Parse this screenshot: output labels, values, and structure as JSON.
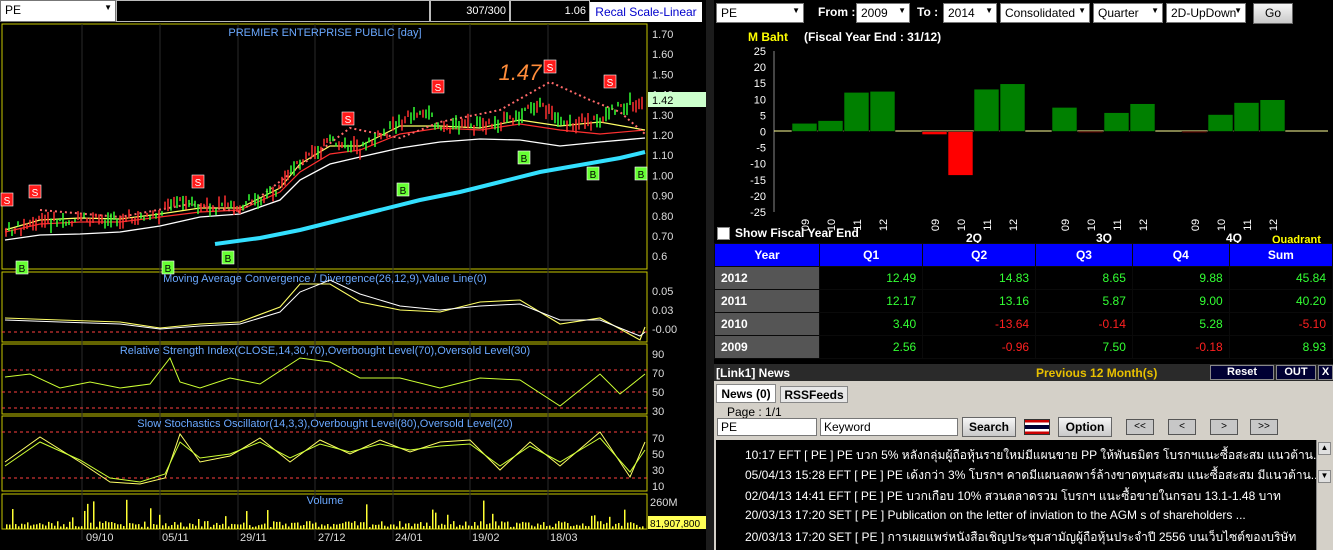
{
  "chart_header": {
    "symbol": "PE",
    "bars_count": "307/300",
    "zoom": "1.06",
    "scale_button": "Recal Scale-Linear",
    "title": "PREMIER ENTERPRISE PUBLIC [day]",
    "peak_label": "1.47",
    "last_price": "1.42"
  },
  "price_axis": [
    "1.70",
    "1.60",
    "1.50",
    "1.40",
    "1.30",
    "1.20",
    "1.10",
    "1.00",
    "0.90",
    "0.80",
    "0.70",
    "0.6"
  ],
  "indicators": {
    "macd": {
      "title": "Moving Average Convergence / Divergence(26,12,9),Value Line(0)",
      "ticks": [
        "0.05",
        "0.03",
        "-0.00"
      ]
    },
    "rsi": {
      "title": "Relative Strength Index(CLOSE,14,30,70),Overbought Level(70),Oversold Level(30)",
      "ticks": [
        "90",
        "70",
        "50",
        "30"
      ]
    },
    "stoch": {
      "title": "Slow Stochastics Oscillator(14,3,3),Overbought Level(80),Oversold Level(20)",
      "ticks": [
        "70",
        "50",
        "30",
        "10"
      ]
    },
    "volume": {
      "title": "Volume",
      "ticks": [
        "260M"
      ],
      "last": "81,907,800"
    }
  },
  "date_axis": [
    "09/10",
    "05/11",
    "29/11",
    "27/12",
    "24/01",
    "19/02",
    "18/03"
  ],
  "signals": {
    "sell": "S",
    "buy": "B"
  },
  "financial": {
    "symbol": "PE",
    "from_label": "From :",
    "from_year": "2009",
    "to_label": "To :",
    "to_year": "2014",
    "mode": "Consolidated",
    "period": "Quarter",
    "view": "2D-UpDown",
    "go_label": "Go",
    "chart_title": "M Baht",
    "fiscal_note": "(Fiscal Year End : 31/12)",
    "show_fiscal_label": "Show Fiscal Year End",
    "quadrant_label": "Quadrant"
  },
  "chart_data": {
    "type": "bar",
    "title": "M Baht",
    "subtitle": "(Fiscal Year End : 31/12)",
    "ylim": [
      -25,
      25
    ],
    "yticks": [
      "25",
      "20",
      "15",
      "10",
      "5",
      "0",
      "-5",
      "-10",
      "-15",
      "-20",
      "-25"
    ],
    "groups": [
      {
        "name": "1Q",
        "categories": [
          "09",
          "10",
          "11",
          "12"
        ],
        "values": [
          2.56,
          3.4,
          12.17,
          12.49
        ]
      },
      {
        "name": "2Q",
        "categories": [
          "09",
          "10",
          "11",
          "12"
        ],
        "values": [
          -0.96,
          -13.64,
          13.16,
          14.83
        ]
      },
      {
        "name": "3Q",
        "categories": [
          "09",
          "10",
          "11",
          "12"
        ],
        "values": [
          7.5,
          -0.14,
          5.87,
          8.65
        ]
      },
      {
        "name": "4Q",
        "categories": [
          "09",
          "10",
          "11",
          "12"
        ],
        "values": [
          -0.18,
          5.28,
          9.0,
          9.88
        ]
      }
    ],
    "group_labels_visible": [
      "2Q",
      "3Q",
      "4Q"
    ],
    "pos_color": "#008000",
    "neg_color": "#ff0000"
  },
  "table": {
    "headers": [
      "Year",
      "Q1",
      "Q2",
      "Q3",
      "Q4",
      "Sum"
    ],
    "rows": [
      [
        "2012",
        "12.49",
        "14.83",
        "8.65",
        "9.88",
        "45.84"
      ],
      [
        "2011",
        "12.17",
        "13.16",
        "5.87",
        "9.00",
        "40.20"
      ],
      [
        "2010",
        "3.40",
        "-13.64",
        "-0.14",
        "5.28",
        "-5.10"
      ],
      [
        "2009",
        "2.56",
        "-0.96",
        "7.50",
        "-0.18",
        "8.93"
      ]
    ]
  },
  "news_panel": {
    "title": "[Link1] News",
    "range": "Previous 12 Month(s)",
    "reset": "Reset",
    "out": "OUT",
    "close": "X",
    "tabs": [
      "News (0)",
      "RSSFeeds"
    ],
    "page": "Page : 1/1",
    "symbol": "PE",
    "keyword_placeholder": "Keyword",
    "search": "Search",
    "option": "Option",
    "nav": [
      "<<",
      "<",
      ">",
      ">>"
    ],
    "items": [
      "10:17  EFT  [ PE ]  PE บวก 5% หลังกลุ่มผู้ถือหุ้นรายใหม่มีแผนขาย PP ให้พันธมิตร  โบรกฯแนะซื้อสะสม แนวต้าน...",
      "05/04/13 15:28  EFT  [ PE ]  PE เด้งกว่า 3% โบรกฯ คาดมีแผนลดพาร์ล้างขาดทุนสะสม แนะซื้อสะสม มีแนวต้าน...",
      "02/04/13 14:41  EFT  [ PE ]  PE บวกเกือบ 10% สวนตลาดรวม โบรกฯ แนะซื้อขายในกรอบ 13.1-1.48 บาท",
      "20/03/13 17:20  SET  [ PE ]  Publication on the letter of inviation to the AGM s of shareholders ...",
      "20/03/13 17:20  SET  [ PE ]  การเผยแพร่หนังสือเชิญประชุมสามัญผู้ถือหุ้นประจำปี 2556 บนเว็บไซต์ของบริษัท"
    ]
  }
}
